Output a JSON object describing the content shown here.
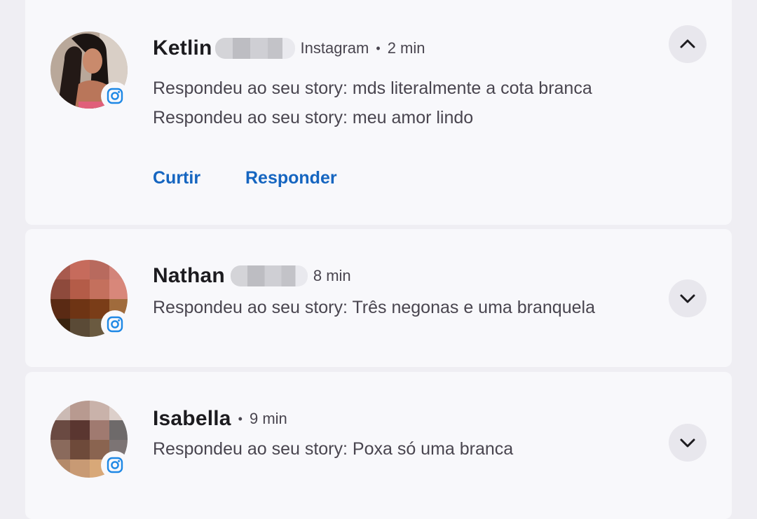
{
  "notifications": [
    {
      "name": "Ketlin",
      "source": "Instagram",
      "time": "2 min",
      "expanded": true,
      "messages": [
        "Respondeu ao seu story: mds literalmente a cota branca",
        "Respondeu ao seu story: meu amor lindo"
      ],
      "actions": [
        "Curtir",
        "Responder"
      ]
    },
    {
      "name": "Nathan",
      "time": "8 min",
      "expanded": false,
      "messages": [
        "Respondeu ao seu story: Três negonas e uma branquela"
      ]
    },
    {
      "name": "Isabella",
      "time": "9 min",
      "expanded": false,
      "messages": [
        "Respondeu ao seu story: Poxa só uma branca"
      ]
    }
  ],
  "colors": {
    "action_blue": "#1565c0",
    "instagram_badge": "#1e88e5",
    "card_bg": "#f8f8fb",
    "page_bg": "#efeef3"
  },
  "icons": {
    "badge": "instagram-icon",
    "collapse": "chevron-up-icon",
    "expand": "chevron-down-icon"
  }
}
